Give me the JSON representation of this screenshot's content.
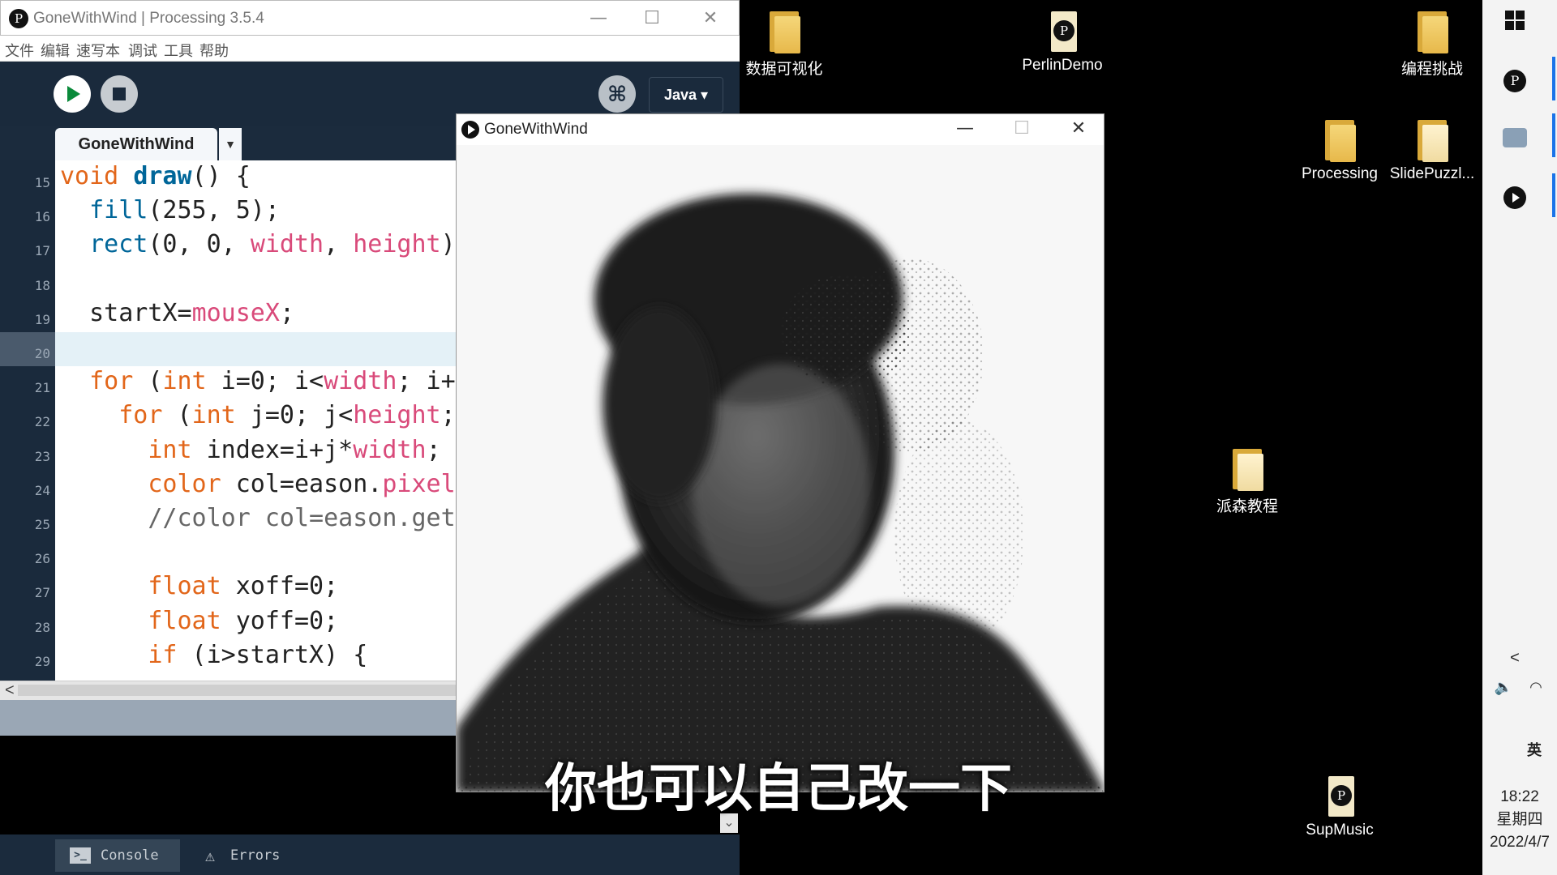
{
  "ide": {
    "title": "GoneWithWind | Processing 3.5.4",
    "menu": [
      "文件",
      "编辑",
      "速写本",
      "调试",
      "工具",
      "帮助"
    ],
    "mode": "Java ▾",
    "tab_name": "GoneWithWind",
    "tab_dropdown": "▼",
    "line_numbers": [
      "15",
      "16",
      "17",
      "18",
      "19",
      "20",
      "21",
      "22",
      "23",
      "24",
      "25",
      "26",
      "27",
      "28",
      "29"
    ],
    "code_lines": [
      "void draw() {",
      "  fill(255, 5);",
      "  rect(0, 0, width, height)",
      "",
      "  startX=mouseX;",
      "",
      "  for (int i=0; i<width; i+",
      "    for (int j=0; j<height;",
      "      int index=i+j*width;",
      "      color col=eason.pixel",
      "      //color col=eason.get",
      "",
      "      float xoff=0;",
      "      float yoff=0;",
      "      if (i>startX) {"
    ],
    "console_tab": "Console",
    "errors_tab": "Errors",
    "scroll_left": "<",
    "scroll_down": "⌄"
  },
  "sketch": {
    "title": "GoneWithWind"
  },
  "desktop": {
    "icons": [
      {
        "label": "数据可视化",
        "type": "folder"
      },
      {
        "label": "PerlinDemo",
        "type": "processing"
      },
      {
        "label": "编程挑战",
        "type": "folder"
      },
      {
        "label": "Processing",
        "type": "folder"
      },
      {
        "label": "SlidePuzzl...",
        "type": "folder"
      },
      {
        "label": "派森教程",
        "type": "folder"
      },
      {
        "label": "SupMusic",
        "type": "processing"
      }
    ]
  },
  "taskbar": {
    "time": "18:22",
    "weekday": "星期四",
    "date": "2022/4/7",
    "ime": "英",
    "chevron": "<"
  },
  "subtitle": "你也可以自己改一下",
  "colors": {
    "ide_bg": "#1b2b3d",
    "run_green": "#0a8a3a",
    "keyword_orange": "#e2661a",
    "keyword_blue": "#006699",
    "builtin_pink": "#d94a7a",
    "comment_gray": "#666666"
  }
}
